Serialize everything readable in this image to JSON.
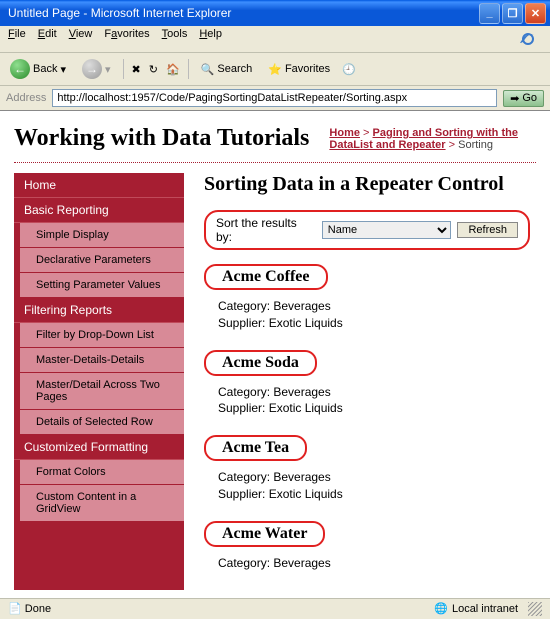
{
  "window": {
    "title": "Untitled Page - Microsoft Internet Explorer"
  },
  "menu": {
    "file": "File",
    "edit": "Edit",
    "view": "View",
    "favorites": "Favorites",
    "tools": "Tools",
    "help": "Help"
  },
  "toolbar": {
    "back": "Back",
    "search": "Search",
    "favorites": "Favorites"
  },
  "address": {
    "label": "Address",
    "url": "http://localhost:1957/Code/PagingSortingDataListRepeater/Sorting.aspx",
    "go": "Go"
  },
  "site_title": "Working with Data Tutorials",
  "breadcrumb": {
    "home": "Home",
    "section": "Paging and Sorting with the DataList and Repeater",
    "current": "Sorting"
  },
  "nav": [
    {
      "type": "sec",
      "label": "Home"
    },
    {
      "type": "sec",
      "label": "Basic Reporting"
    },
    {
      "type": "item",
      "label": "Simple Display"
    },
    {
      "type": "item",
      "label": "Declarative Parameters"
    },
    {
      "type": "item",
      "label": "Setting Parameter Values"
    },
    {
      "type": "sec",
      "label": "Filtering Reports"
    },
    {
      "type": "item",
      "label": "Filter by Drop-Down List"
    },
    {
      "type": "item",
      "label": "Master-Details-Details"
    },
    {
      "type": "item",
      "label": "Master/Detail Across Two Pages"
    },
    {
      "type": "item",
      "label": "Details of Selected Row"
    },
    {
      "type": "sec",
      "label": "Customized Formatting"
    },
    {
      "type": "item",
      "label": "Format Colors"
    },
    {
      "type": "item",
      "label": "Custom Content in a GridView"
    }
  ],
  "main": {
    "heading": "Sorting Data in a Repeater Control",
    "sort_label": "Sort the results by:",
    "sort_selected": "Name",
    "refresh": "Refresh"
  },
  "products": [
    {
      "name": "Acme Coffee",
      "category": "Beverages",
      "supplier": "Exotic Liquids"
    },
    {
      "name": "Acme Soda",
      "category": "Beverages",
      "supplier": "Exotic Liquids"
    },
    {
      "name": "Acme Tea",
      "category": "Beverages",
      "supplier": "Exotic Liquids"
    },
    {
      "name": "Acme Water",
      "category": "Beverages",
      "supplier": ""
    }
  ],
  "labels": {
    "category": "Category:",
    "supplier": "Supplier:"
  },
  "status": {
    "left": "Done",
    "right": "Local intranet"
  }
}
